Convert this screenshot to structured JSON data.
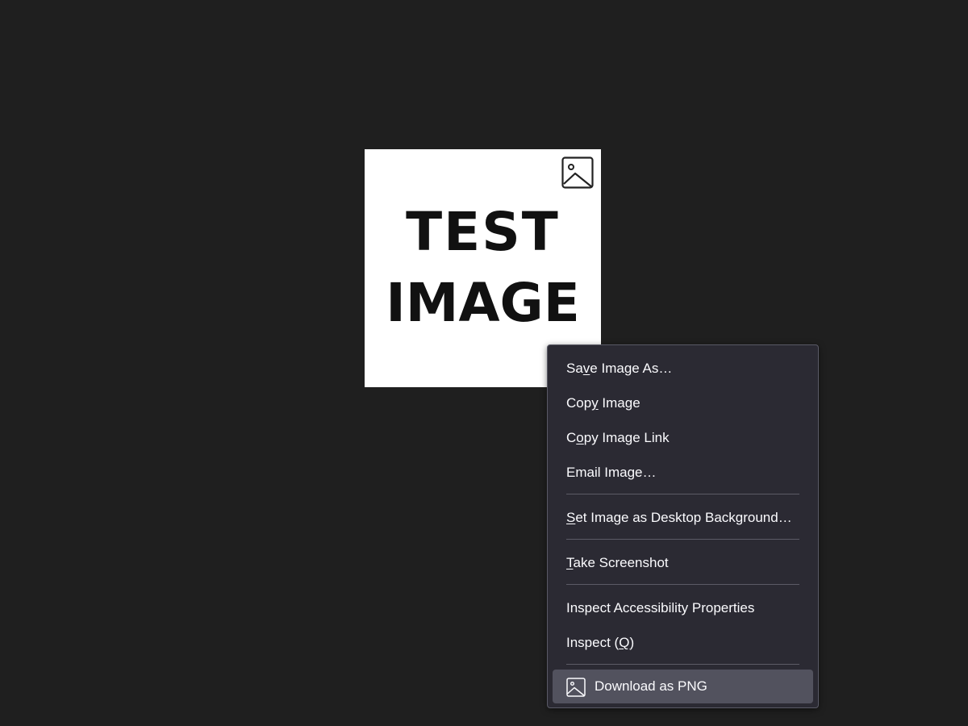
{
  "image": {
    "line1": "TEST",
    "line2": "IMAGE",
    "corner_icon": "image-icon"
  },
  "context_menu": {
    "items": [
      {
        "pre": "Sa",
        "key": "v",
        "post": "e Image As…"
      },
      {
        "pre": "Cop",
        "key": "y",
        "post": " Image"
      },
      {
        "pre": "C",
        "key": "o",
        "post": "py Image Link"
      },
      {
        "pre": "Email Image…",
        "key": "",
        "post": ""
      },
      {
        "pre": "",
        "key": "S",
        "post": "et Image as Desktop Background…"
      },
      {
        "pre": "",
        "key": "T",
        "post": "ake Screenshot"
      },
      {
        "pre": "Inspect Accessibility Properties",
        "key": "",
        "post": ""
      },
      {
        "pre": "Inspect (",
        "key": "Q",
        "post": ")"
      }
    ],
    "download": {
      "label": "Download as PNG",
      "icon": "image-icon"
    }
  },
  "colors": {
    "background": "#1f1f1f",
    "menu_bg": "#2b2a33",
    "menu_highlight": "#52525e",
    "menu_text": "#fbfbfe"
  }
}
